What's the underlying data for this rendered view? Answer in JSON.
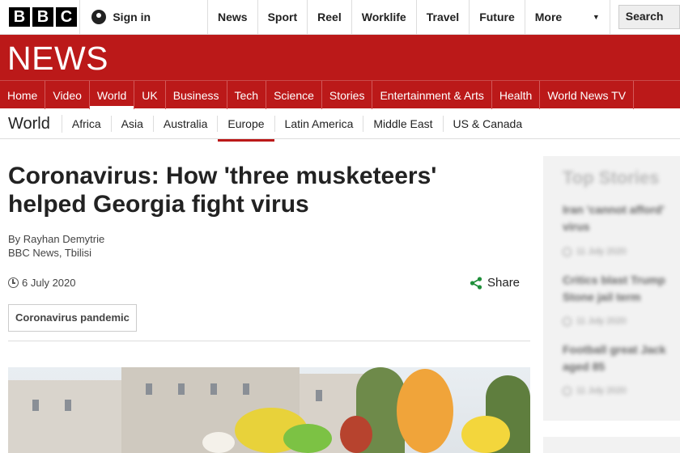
{
  "masthead": {
    "logo_letters": [
      "B",
      "B",
      "C"
    ],
    "signin_label": "Sign in",
    "nav": [
      "News",
      "Sport",
      "Reel",
      "Worklife",
      "Travel",
      "Future"
    ],
    "more_label": "More",
    "search_label": "Search"
  },
  "news_band": {
    "title": "NEWS",
    "primary_nav": [
      "Home",
      "Video",
      "World",
      "UK",
      "Business",
      "Tech",
      "Science",
      "Stories",
      "Entertainment & Arts",
      "Health",
      "World News TV"
    ],
    "active_item": "World"
  },
  "secondary_nav": {
    "section_title": "World",
    "items": [
      "Africa",
      "Asia",
      "Australia",
      "Europe",
      "Latin America",
      "Middle East",
      "US & Canada"
    ],
    "active_item": "Europe"
  },
  "article": {
    "headline_line1": "Coronavirus: How 'three musketeers'",
    "headline_line2": "helped Georgia fight virus",
    "byline_author": "By Rayhan Demytrie",
    "byline_outlet": "BBC News, Tbilisi",
    "date": "6 July 2020",
    "share_label": "Share",
    "tag": "Coronavirus pandemic"
  },
  "sidebar": {
    "title": "Top Stories",
    "stories": [
      {
        "title_line1": "Iran 'cannot afford'",
        "title_line2": "virus",
        "date": "11 July 2020"
      },
      {
        "title_line1": "Critics blast Trump",
        "title_line2": "Stone jail term",
        "date": "11 July 2020"
      },
      {
        "title_line1": "Football great Jack",
        "title_line2": "aged 85",
        "date": "11 July 2020"
      }
    ]
  },
  "colors": {
    "brand_red": "#bb1919",
    "share_green": "#1f8f3a"
  }
}
